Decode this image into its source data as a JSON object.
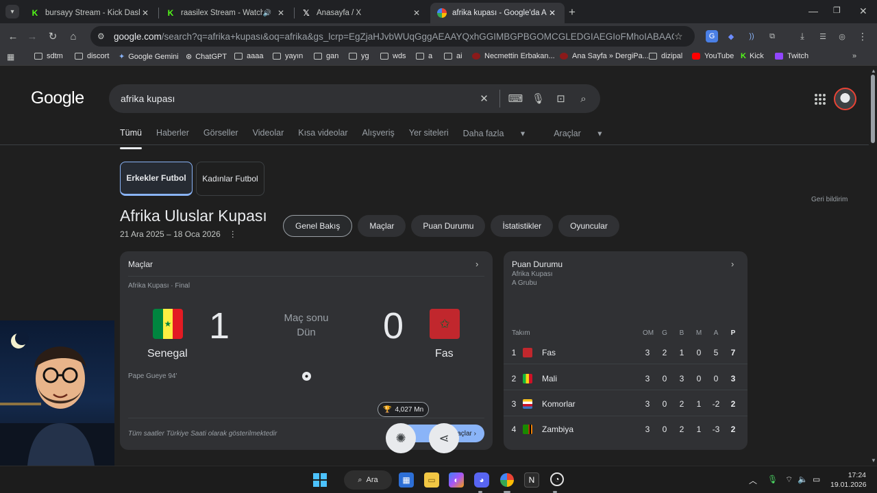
{
  "browser": {
    "tabs": [
      {
        "title": "bursayy Stream - Kick Dashboar",
        "favicon": "kick-icon",
        "active": false
      },
      {
        "title": "raasilex Stream - Watch Live",
        "favicon": "kick-icon",
        "active": false,
        "audio": true
      },
      {
        "title": "Anasayfa / X",
        "favicon": "x-icon",
        "active": false
      },
      {
        "title": "afrika kupası - Google'da Ara",
        "favicon": "google-icon",
        "active": true
      }
    ],
    "url_main": "google.com",
    "url_rest": "/search?q=afrika+kupası&oq=afrika&gs_lcrp=EgZjaHJvbWUqGggAEAAYQxhGGIMBGPBGOMCGLEDGIAEGIoFMhoIABAAGEMYRhiDARj9ARjjAhix...",
    "bookmarks": [
      {
        "label": "sdtm",
        "icon": "folder-icon"
      },
      {
        "label": "discort",
        "icon": "folder-icon"
      },
      {
        "label": "Google Gemini",
        "icon": "gemini-icon"
      },
      {
        "label": "ChatGPT",
        "icon": "chatgpt-icon"
      },
      {
        "label": "aaaa",
        "icon": "folder-icon"
      },
      {
        "label": "yayın",
        "icon": "folder-icon"
      },
      {
        "label": "gan",
        "icon": "folder-icon"
      },
      {
        "label": "yg",
        "icon": "folder-icon"
      },
      {
        "label": "wds",
        "icon": "folder-icon"
      },
      {
        "label": "a",
        "icon": "folder-icon"
      },
      {
        "label": "ai",
        "icon": "folder-icon"
      },
      {
        "label": "Necmettin Erbakan...",
        "icon": "site-icon"
      },
      {
        "label": "Ana Sayfa » DergiPa...",
        "icon": "site-icon"
      },
      {
        "label": "dizipal",
        "icon": "folder-icon"
      },
      {
        "label": "YouTube",
        "icon": "youtube-icon"
      },
      {
        "label": "Kick",
        "icon": "kick-icon"
      },
      {
        "label": "Twitch",
        "icon": "twitch-icon"
      }
    ]
  },
  "google": {
    "logo": "Google",
    "query": "afrika kupası",
    "nav_tabs": [
      "Tümü",
      "Haberler",
      "Görseller",
      "Videolar",
      "Kısa videolar",
      "Alışveriş",
      "Yer siteleri",
      "Daha fazla",
      "Araçlar"
    ],
    "gender_tabs": [
      "Erkekler Futbol",
      "Kadınlar Futbol"
    ],
    "feedback": "Geri bildirim"
  },
  "tournament": {
    "title": "Afrika Uluslar Kupası",
    "dates": "21 Ara 2025 – 18 Oca 2026",
    "pills": [
      "Genel Bakış",
      "Maçlar",
      "Puan Durumu",
      "İstatistikler",
      "Oyuncular"
    ]
  },
  "matches_card": {
    "header": "Maçlar",
    "round": "Afrika Kupası · Final",
    "home": {
      "name": "Senegal",
      "score": "1"
    },
    "away": {
      "name": "Fas",
      "score": "0"
    },
    "status_line1": "Maç sonu",
    "status_line2": "Dün",
    "scorer": "Pape Gueye 94'",
    "timezone_note": "Tüm saatler Türkiye Saati olarak gösterilmektedir",
    "all_matches_button": "Tüm Maçlar",
    "views_badge": "4,027 Mn"
  },
  "standings_card": {
    "header": "Puan Durumu",
    "sub1": "Afrika Kupası",
    "sub2": "A Grubu",
    "columns": [
      "Takım",
      "OM",
      "G",
      "B",
      "M",
      "A",
      "P"
    ],
    "rows": [
      {
        "rank": "1",
        "team": "Fas",
        "om": "3",
        "g": "2",
        "b": "1",
        "m": "0",
        "a": "5",
        "p": "7",
        "flag": "#c1272d"
      },
      {
        "rank": "2",
        "team": "Mali",
        "om": "3",
        "g": "0",
        "b": "3",
        "m": "0",
        "a": "0",
        "p": "3",
        "flag": "#14b53a"
      },
      {
        "rank": "3",
        "team": "Komorlar",
        "om": "3",
        "g": "0",
        "b": "2",
        "m": "1",
        "a": "-2",
        "p": "2",
        "flag": "#3a75c4"
      },
      {
        "rank": "4",
        "team": "Zambiya",
        "om": "3",
        "g": "0",
        "b": "2",
        "m": "1",
        "a": "-3",
        "p": "2",
        "flag": "#198a00"
      }
    ]
  },
  "taskbar": {
    "search_label": "Ara",
    "time": "17:24",
    "date": "19.01.2026"
  },
  "colors": {
    "accent_blue": "#8ab4f8",
    "page_bg": "#1f1f1f",
    "card_bg": "#303134",
    "kick_green": "#53fc18"
  }
}
